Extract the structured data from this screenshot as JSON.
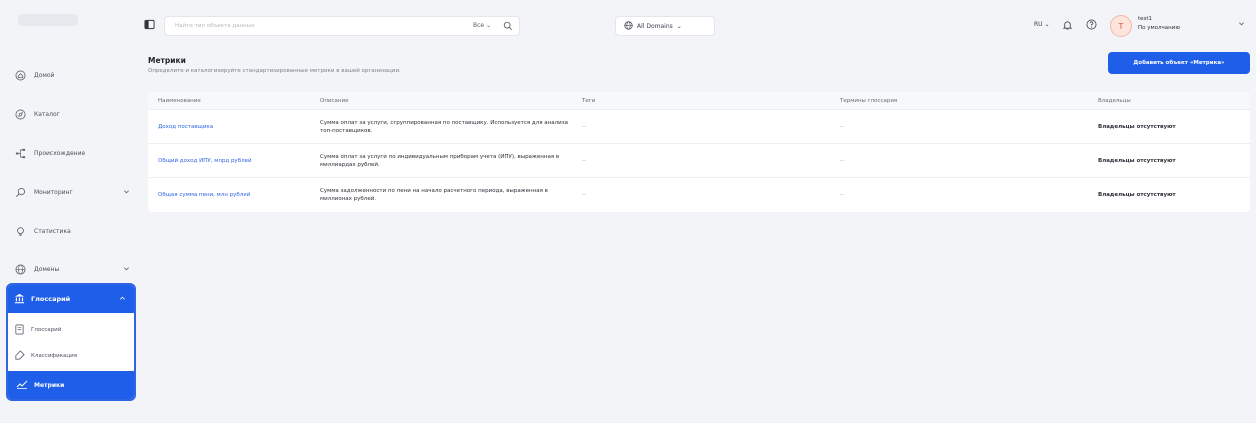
{
  "sidebar": {
    "items": [
      {
        "label": "Домой",
        "icon": "home-icon"
      },
      {
        "label": "Каталог",
        "icon": "compass-icon"
      },
      {
        "label": "Происхождение",
        "icon": "lineage-icon"
      },
      {
        "label": "Мониторинг",
        "icon": "monitor-icon"
      },
      {
        "label": "Статистика",
        "icon": "bulb-icon"
      },
      {
        "label": "Домены",
        "icon": "globe-icon"
      }
    ],
    "glossary_group": {
      "label": "Глоссарий",
      "icon": "bank-icon",
      "children": [
        {
          "label": "Глоссарий",
          "icon": "book-icon"
        },
        {
          "label": "Классификация",
          "icon": "tag-icon"
        },
        {
          "label": "Метрики",
          "icon": "chart-icon"
        }
      ]
    }
  },
  "topbar": {
    "search_placeholder": "Найти тип объекта данных",
    "search_scope": "Все",
    "domains": "All Domains",
    "lang": "RU",
    "avatar_letter": "T",
    "user_name": "test1",
    "user_role": "По умолчанию"
  },
  "page": {
    "title": "Метрики",
    "subtitle": "Определите и каталогизируйте стандартизированные метрики в вашей организации.",
    "add_button": "Добавить объект «Метрика»"
  },
  "table": {
    "headers": [
      "Наименование",
      "Описание",
      "Теги",
      "Термины глоссария",
      "Владельцы"
    ],
    "rows": [
      {
        "name": "Доход поставщика",
        "description": "Сумма оплат за услуги, сгруппированная по поставщику. Используется для анализа топ-поставщиков.",
        "tags": "--",
        "terms": "--",
        "owners": "Владельцы отсутствуют"
      },
      {
        "name": "Общий доход ИПУ, млрд рублей",
        "description": "Сумма оплат за услуги по индивидуальным приборам учета (ИПУ), выраженная в миллиардах рублей.",
        "tags": "--",
        "terms": "--",
        "owners": "Владельцы отсутствуют"
      },
      {
        "name": "Общая сумма пени, млн рублей",
        "description": "Сумма задолженности по пени на начало расчетного периода, выраженная в миллионах рублей.",
        "tags": "--",
        "terms": "--",
        "owners": "Владельцы отсутствуют"
      }
    ]
  },
  "colors": {
    "accent": "#1f5ee8",
    "link": "#2f64e4",
    "background": "#f3f4f7"
  }
}
